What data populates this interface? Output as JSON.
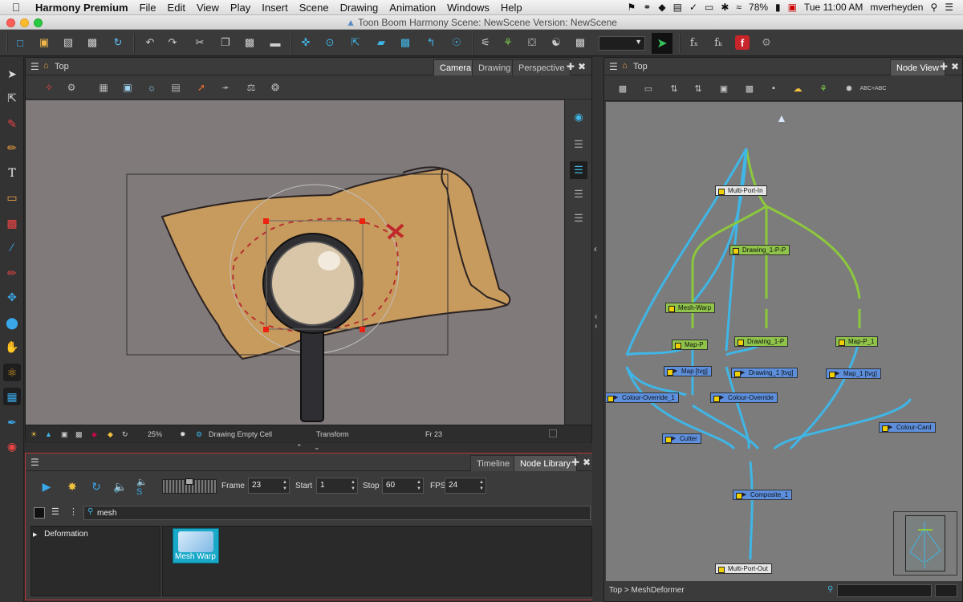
{
  "menubar": {
    "app_name": "Harmony Premium",
    "menus": [
      "File",
      "Edit",
      "View",
      "Play",
      "Insert",
      "Scene",
      "Drawing",
      "Animation",
      "Windows",
      "Help"
    ],
    "battery": "78%",
    "time": "Tue 11:00 AM",
    "user": "mverheyden"
  },
  "window": {
    "title": "Toon Boom Harmony Scene: NewScene Version: NewScene"
  },
  "camera_panel": {
    "breadcrumb": "Top",
    "tabs": [
      "Camera",
      "Drawing",
      "Perspective"
    ],
    "active_tab": "Camera",
    "status": {
      "zoom": "25%",
      "cell": "Drawing Empty Cell",
      "tool": "Transform",
      "frame": "Fr 23"
    }
  },
  "library_panel": {
    "tabs": [
      "Timeline",
      "Node Library"
    ],
    "active_tab": "Node Library",
    "playback": {
      "frame_label": "Frame",
      "frame_value": "23",
      "start_label": "Start",
      "start_value": "1",
      "stop_label": "Stop",
      "stop_value": "60",
      "fps_label": "FPS",
      "fps_value": "24"
    },
    "search_value": "mesh",
    "tree": [
      {
        "label": "Deformation"
      }
    ],
    "items": [
      {
        "label": "Mesh Warp"
      }
    ]
  },
  "node_panel": {
    "breadcrumb": "Top",
    "tab": "Node View",
    "text_tool": "ABC+ABC",
    "status_path": "Top  >  MeshDeformer",
    "nodes": {
      "multi_port_in": "Multi-Port-In",
      "drawing_1_p_p": "Drawing_1-P-P",
      "mesh_warp": "Mesh-Warp",
      "map_p": "Map-P",
      "drawing_1_p": "Drawing_1-P",
      "map_p_1": "Map-P_1",
      "map_tvg": "Map [tvg]",
      "drawing_1_tvg": "Drawing_1 [tvg]",
      "map_1_tvg": "Map_1 [tvg]",
      "colour_override_1": "Colour-Override_1",
      "colour_override": "Colour-Override",
      "cutter": "Cutter",
      "colour_card": "Colour-Card",
      "composite_1": "Composite_1",
      "multi_port_out": "Multi-Port-Out"
    }
  },
  "colors": {
    "accent_blue": "#39a7e8",
    "node_green": "#8fc34a",
    "node_blue": "#5d8fdd",
    "cable_blue": "#3fb6e6",
    "cable_green": "#8cc83c",
    "highlight_border": "#bb3333"
  }
}
